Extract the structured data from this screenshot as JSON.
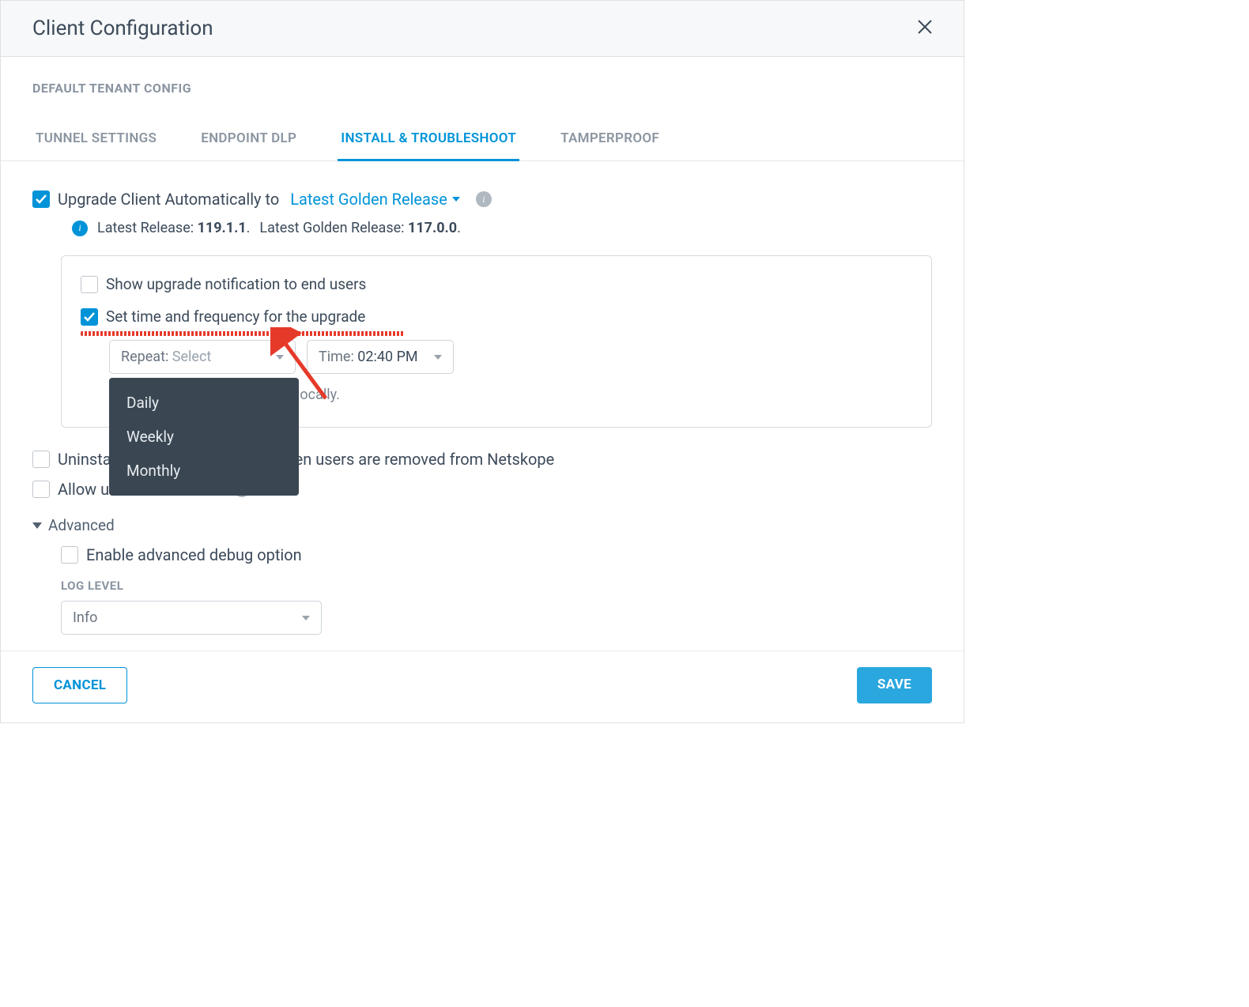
{
  "header": {
    "title": "Client Configuration"
  },
  "subheading": "DEFAULT TENANT CONFIG",
  "tabs": [
    {
      "label": "TUNNEL SETTINGS",
      "active": false
    },
    {
      "label": "ENDPOINT DLP",
      "active": false
    },
    {
      "label": "INSTALL & TROUBLESHOOT",
      "active": true
    },
    {
      "label": "TAMPERPROOF",
      "active": false
    }
  ],
  "upgrade": {
    "label": "Upgrade Client Automatically to",
    "release_option": "Latest Golden Release",
    "latest_release_label": "Latest Release:",
    "latest_release_value": "119.1.1",
    "latest_golden_label": "Latest Golden Release:",
    "latest_golden_value": "117.0.0",
    "show_notification_label": "Show upgrade notification to end users",
    "set_time_label": "Set time and frequency for the upgrade",
    "repeat_label": "Repeat:",
    "repeat_placeholder": "Select",
    "time_label": "Time:",
    "time_value": "02:40 PM",
    "hint": "The time works for each user locally.",
    "repeat_options": [
      "Daily",
      "Weekly",
      "Monthly"
    ]
  },
  "uninstall_label": "Uninstall Clients automatically when users are removed from Netskope",
  "reenroll_label": "Allow users to re-enroll",
  "advanced": {
    "heading": "Advanced",
    "debug_label": "Enable advanced debug option",
    "loglevel_heading": "LOG LEVEL",
    "loglevel_value": "Info"
  },
  "footer": {
    "cancel": "CANCEL",
    "save": "SAVE"
  }
}
